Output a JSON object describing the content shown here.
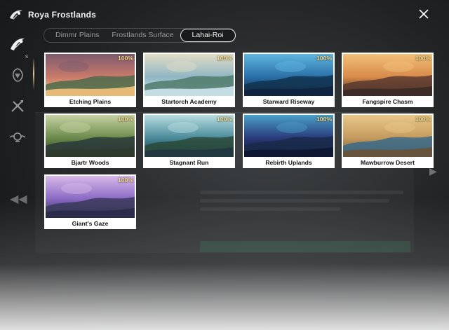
{
  "header": {
    "title": "Roya Frostlands",
    "logo_icon": "swordsman-emblem-icon",
    "close_icon": "close-x-icon"
  },
  "sidebar": {
    "items": [
      {
        "icon": "hero-emblem-icon",
        "active": true,
        "badge": "S"
      },
      {
        "icon": "warrior-portrait-icon",
        "active": false
      },
      {
        "icon": "crossed-weapons-icon",
        "active": false
      },
      {
        "icon": "orb-winged-icon",
        "active": false
      }
    ]
  },
  "tabs": [
    {
      "label": "Dimmr Plains",
      "active": false
    },
    {
      "label": "Frostlands Surface",
      "active": false
    },
    {
      "label": "Lahai-Roi",
      "active": true
    }
  ],
  "locations": [
    {
      "name": "Etching Plains",
      "progress": "100%",
      "palette": [
        "#f4c27a",
        "#c97a6a",
        "#7d5a6e",
        "#4a6a4a"
      ]
    },
    {
      "name": "Startorch Academy",
      "progress": "100%",
      "palette": [
        "#cfe6ee",
        "#8fb6c4",
        "#e2ddc6",
        "#4f7a6a"
      ]
    },
    {
      "name": "Starward Riseway",
      "progress": "100%",
      "palette": [
        "#0f2440",
        "#2a6fa6",
        "#5fb6e0",
        "#12324f"
      ]
    },
    {
      "name": "Fangspire Chasm",
      "progress": "100%",
      "palette": [
        "#3a2a26",
        "#d88a4a",
        "#f2c07a",
        "#5a3a30"
      ]
    },
    {
      "name": "Bjartr Woods",
      "progress": "100%",
      "palette": [
        "#2f3a2a",
        "#6a8a4a",
        "#c8d2a4",
        "#2a3a3a"
      ]
    },
    {
      "name": "Stagnant Run",
      "progress": "100%",
      "palette": [
        "#203640",
        "#4a8a9a",
        "#b8dde0",
        "#2a4a3a"
      ]
    },
    {
      "name": "Rebirth Uplands",
      "progress": "100%",
      "palette": [
        "#0e1630",
        "#2a3a7a",
        "#4aa0c8",
        "#1a2a4a"
      ]
    },
    {
      "name": "Mawburrow Desert",
      "progress": "100%",
      "palette": [
        "#6a5236",
        "#c49a5e",
        "#e8c88a",
        "#3a6a8a"
      ]
    },
    {
      "name": "Giant's Gaze",
      "progress": "100%",
      "palette": [
        "#2a2a4a",
        "#8a6ac4",
        "#d8b8e8",
        "#3a3a5a"
      ]
    }
  ],
  "colors": {
    "accent_gold": "#f4d98a",
    "card_bg": "#ffffff",
    "tab_active_border": "#e8e8e8"
  }
}
